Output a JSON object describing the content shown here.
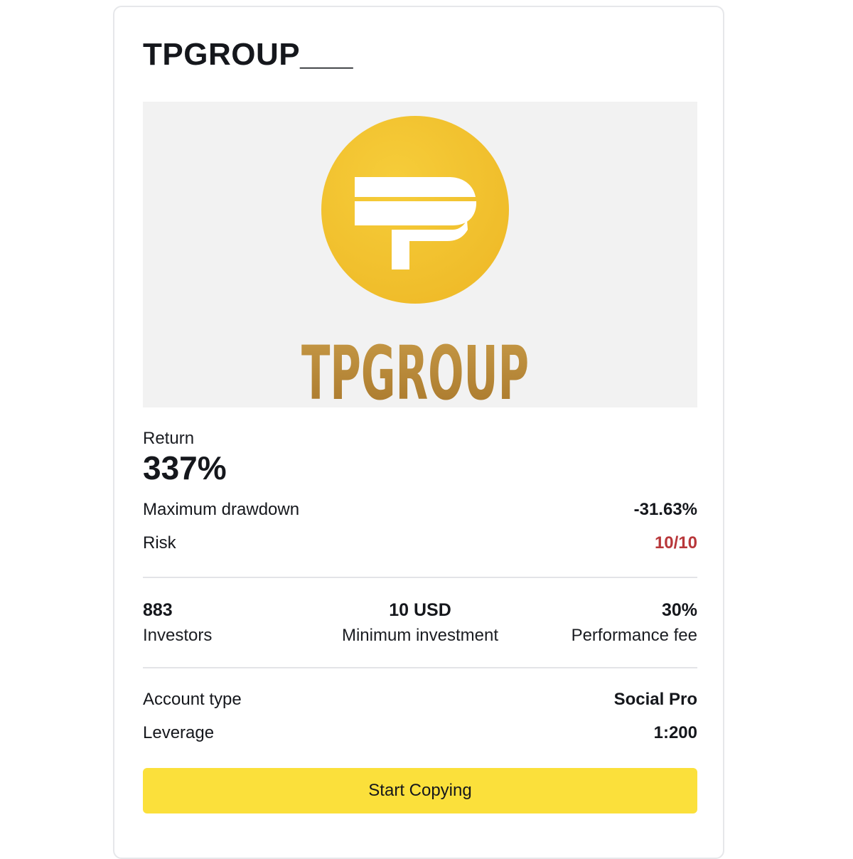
{
  "card": {
    "title": "TPGROUP___",
    "banner": {
      "logo_text": "TPGROUP",
      "logo_icon": "tp-monogram-icon",
      "colors": {
        "circle": "#f2c12c",
        "wordmark": "#b88837",
        "background": "#f2f2f2"
      }
    },
    "return": {
      "label": "Return",
      "value": "337%"
    },
    "metrics": [
      {
        "label": "Maximum drawdown",
        "value": "-31.63%"
      },
      {
        "label": "Risk",
        "value": "10/10"
      }
    ],
    "stats": {
      "investors": {
        "value": "883",
        "label": "Investors"
      },
      "min_investment": {
        "value": "10 USD",
        "label": "Minimum investment"
      },
      "performance_fee": {
        "value": "30%",
        "label": "Performance fee"
      }
    },
    "account": [
      {
        "label": "Account type",
        "value": "Social Pro"
      },
      {
        "label": "Leverage",
        "value": "1:200"
      }
    ],
    "cta_label": "Start Copying",
    "colors": {
      "accent": "#fbe03b",
      "risk": "#b8373a"
    }
  }
}
